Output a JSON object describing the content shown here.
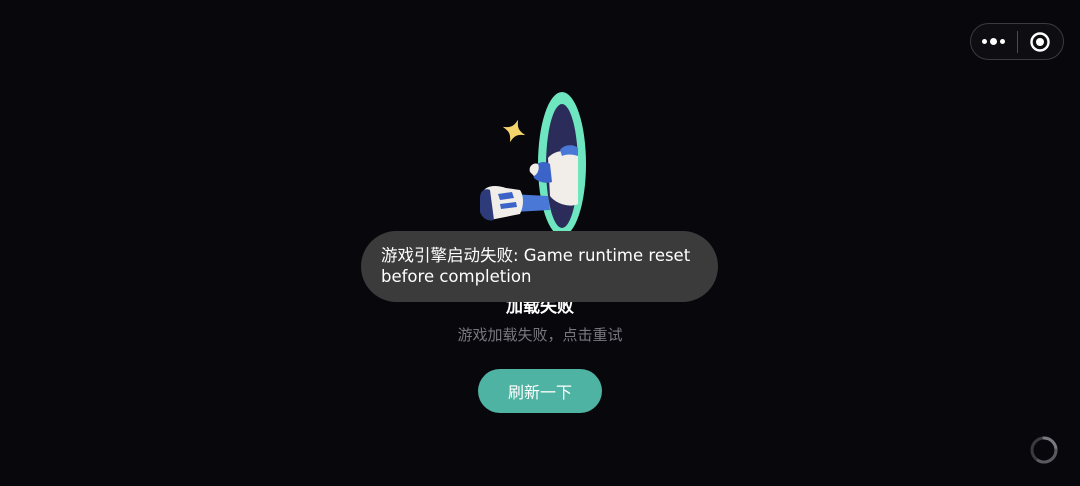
{
  "menu": {
    "more_icon": "more-dots-icon",
    "close_icon": "target-circle-icon"
  },
  "error": {
    "title": "加载失败",
    "subtitle": "游戏加载失败，点击重试",
    "refresh_label": "刷新一下"
  },
  "toast": {
    "message": "游戏引擎启动失败: Game runtime reset before completion"
  },
  "colors": {
    "background": "#07070c",
    "accent": "#4fb3a3",
    "portal": "#6ee7c0",
    "star": "#f3d36b",
    "toast_bg": "#3b3b3c"
  }
}
